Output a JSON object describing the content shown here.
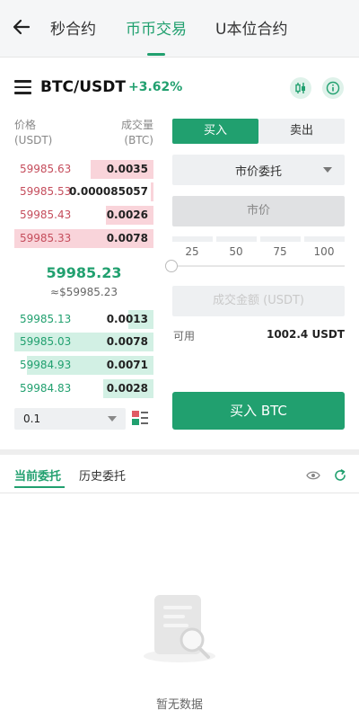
{
  "nav": {
    "tabs": [
      {
        "label": "秒合约"
      },
      {
        "label": "币币交易"
      },
      {
        "label": "U本位合约"
      }
    ],
    "active_tab": "币币交易",
    "accent_color": "#21a06f"
  },
  "pair": {
    "name": "BTC/USDT",
    "change": "+3.62%"
  },
  "orderbook": {
    "price_header": "价格",
    "price_unit": "(USDT)",
    "qty_header": "成交量",
    "qty_unit": "(BTC)",
    "asks": [
      {
        "price": "59985.63",
        "qty": "0.0035",
        "depth": 0.45
      },
      {
        "price": "59985.53",
        "qty": "0.000085057",
        "depth": 0.02
      },
      {
        "price": "59985.43",
        "qty": "0.0026",
        "depth": 0.34
      },
      {
        "price": "59985.33",
        "qty": "0.0078",
        "depth": 1.0
      }
    ],
    "last_price": "59985.23",
    "last_price_fiat": "≈$59985.23",
    "bids": [
      {
        "price": "59985.13",
        "qty": "0.0013",
        "depth": 0.18
      },
      {
        "price": "59985.03",
        "qty": "0.0078",
        "depth": 1.0
      },
      {
        "price": "59984.93",
        "qty": "0.0071",
        "depth": 0.91
      },
      {
        "price": "59984.83",
        "qty": "0.0028",
        "depth": 0.36
      }
    ],
    "depth_value": "0.1"
  },
  "order_form": {
    "buy_label": "买入",
    "sell_label": "卖出",
    "order_type": "市价委托",
    "price_placeholder": "市价",
    "percents": [
      "25",
      "50",
      "75",
      "100"
    ],
    "amount_placeholder": "成交金额 (USDT)",
    "available_label": "可用",
    "available_value": "1002.4 USDT",
    "submit_label": "买入 BTC"
  },
  "orders": {
    "tabs": [
      {
        "label": "当前委托"
      },
      {
        "label": "历史委托"
      }
    ],
    "empty_text": "暂无数据"
  }
}
